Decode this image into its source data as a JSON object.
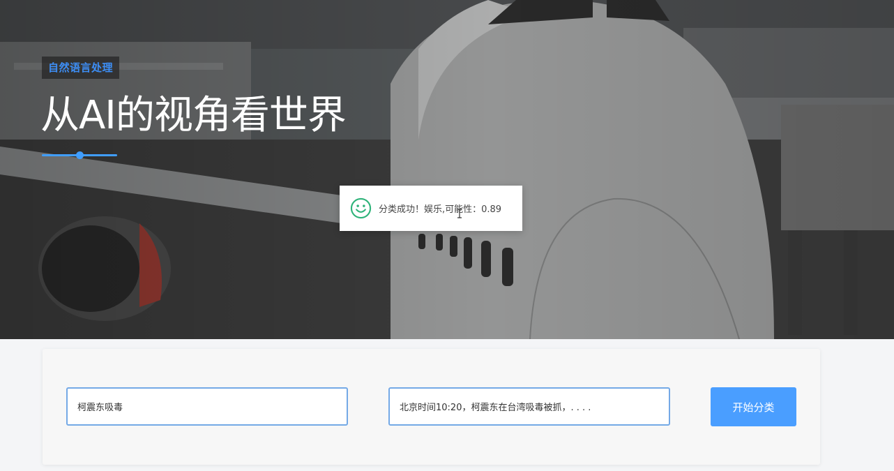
{
  "hero": {
    "tag": "自然语言处理",
    "title": "从AI的视角看世界"
  },
  "toast": {
    "icon": "smile-icon",
    "message": "分类成功！娱乐,可能性：0.89"
  },
  "form": {
    "title_input_value": "柯震东吸毒",
    "content_input_value": "北京时间10:20，柯震东在台湾吸毒被抓，. . . .",
    "submit_label": "开始分类"
  },
  "colors": {
    "accent": "#409eff",
    "button": "#4a9eff",
    "toast_icon": "#2fb37a"
  }
}
